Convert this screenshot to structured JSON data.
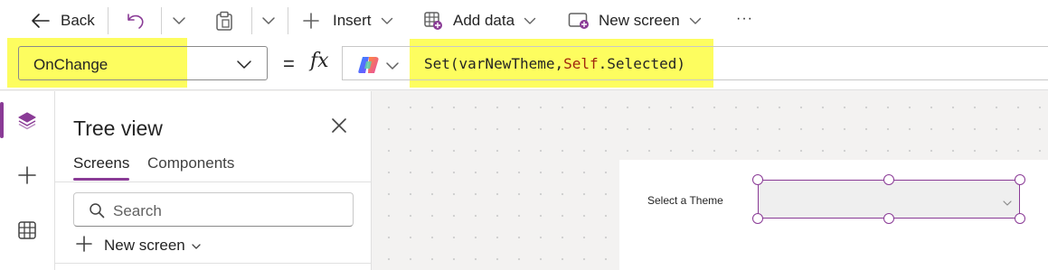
{
  "toolbar": {
    "back_label": "Back",
    "insert_label": "Insert",
    "add_data_label": "Add data",
    "new_screen_label": "New screen",
    "more_label": "···"
  },
  "formula_bar": {
    "property": "OnChange",
    "equals": "=",
    "fx": "fx",
    "formula_tokens": [
      {
        "text": "Set(varNewTheme,",
        "color": "#242424"
      },
      {
        "text": "Self",
        "color": "#a1260d"
      },
      {
        "text": ".Selected)",
        "color": "#242424"
      }
    ],
    "highlight_color": "#fdfd5f"
  },
  "tree_view": {
    "title": "Tree view",
    "tabs": [
      {
        "label": "Screens",
        "active": true
      },
      {
        "label": "Components",
        "active": false
      }
    ],
    "search_placeholder": "Search",
    "new_screen_label": "New screen"
  },
  "canvas": {
    "theme_label": "Select a Theme"
  },
  "colors": {
    "accent": "#8a3b96"
  }
}
